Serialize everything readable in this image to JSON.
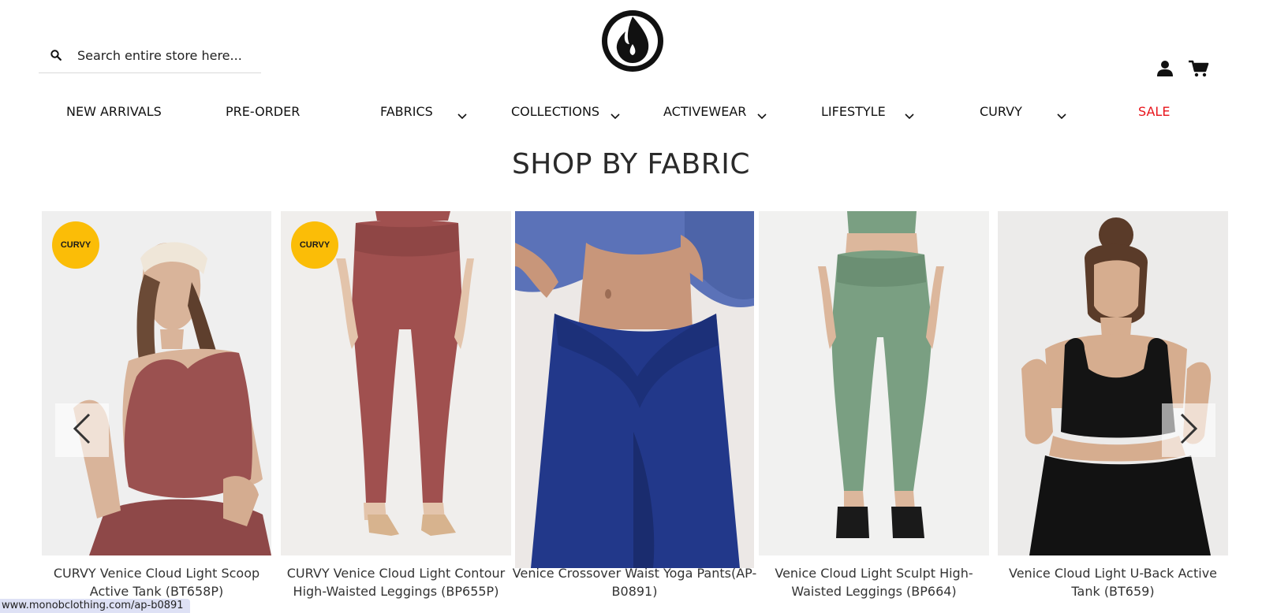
{
  "search": {
    "placeholder": "Search entire store here..."
  },
  "nav": [
    {
      "label": "NEW ARRIVALS",
      "has_dropdown": false
    },
    {
      "label": "PRE-ORDER",
      "has_dropdown": false
    },
    {
      "label": "FABRICS",
      "has_dropdown": true
    },
    {
      "label": "COLLECTIONS",
      "has_dropdown": true
    },
    {
      "label": "ACTIVEWEAR",
      "has_dropdown": true
    },
    {
      "label": "LIFESTYLE",
      "has_dropdown": true
    },
    {
      "label": "CURVY",
      "has_dropdown": true
    },
    {
      "label": "SALE",
      "has_dropdown": false,
      "color": "#e8141b"
    }
  ],
  "section": {
    "title": "SHOP BY FABRIC"
  },
  "products": [
    {
      "name": "CURVY Venice Cloud Light Scoop Active Tank (BT658P)",
      "badge": "CURVY",
      "color": "#9b5150"
    },
    {
      "name": "CURVY Venice Cloud Light Contour High-Waisted Leggings (BP655P)",
      "badge": "CURVY",
      "color": "#a0504f"
    },
    {
      "name": "Venice Crossover Waist Yoga Pants(AP-B0891)",
      "badge": "",
      "color": "#22388a"
    },
    {
      "name": "Venice Cloud Light Sculpt High-Waisted Leggings (BP664)",
      "badge": "",
      "color": "#7a9f82"
    },
    {
      "name": "Venice Cloud Light U-Back Active Tank (BT659)",
      "badge": "",
      "color": "#141414"
    }
  ],
  "icons": {
    "search": "search-icon",
    "account": "user-icon",
    "cart": "cart-icon",
    "prev": "chevron-left-icon",
    "next": "chevron-right-icon",
    "dropdown": "chevron-down-icon"
  },
  "status_bar": {
    "url": "www.monobclothing.com/ap-b0891"
  },
  "colors": {
    "sale": "#e8141b",
    "badge": "#fbbd07",
    "text": "#1a1a1a"
  }
}
